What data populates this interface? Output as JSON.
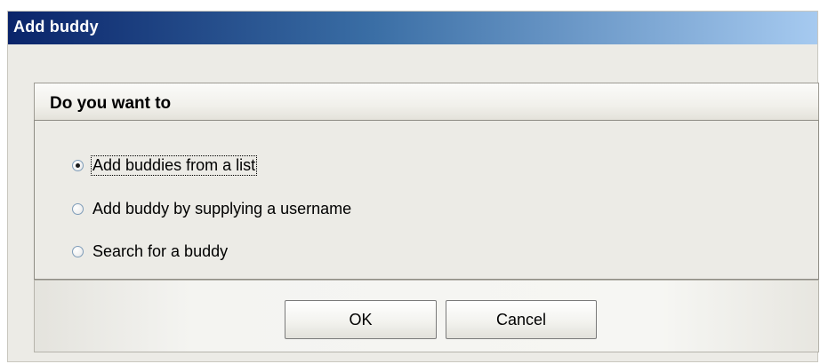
{
  "window": {
    "title": "Add buddy"
  },
  "panel": {
    "header": "Do you want to",
    "options": [
      {
        "label": "Add buddies from a list",
        "checked": true
      },
      {
        "label": "Add buddy by supplying a username",
        "checked": false
      },
      {
        "label": "Search for a buddy",
        "checked": false
      }
    ]
  },
  "buttons": {
    "ok_label": "OK",
    "cancel_label": "Cancel"
  },
  "colors": {
    "titlebar_start": "#0a246a",
    "titlebar_end": "#a6caf0",
    "dialog_background": "#ecebe6"
  }
}
